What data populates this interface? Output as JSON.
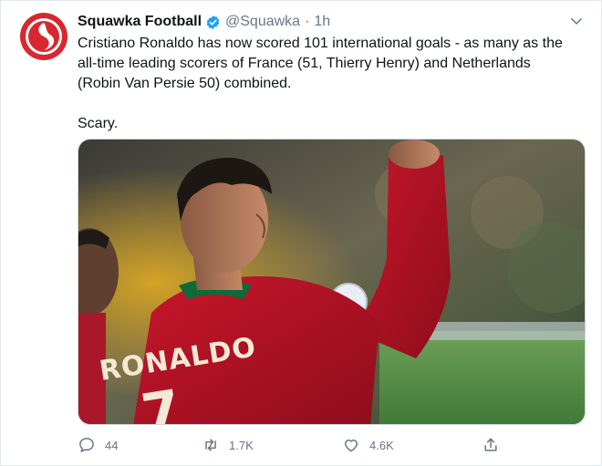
{
  "tweet": {
    "display_name": "Squawka Football",
    "handle": "@Squawka",
    "separator": "·",
    "time": "1h",
    "text_lines": [
      "Cristiano Ronaldo has now scored 101 international goals - as many as the",
      "all-time leading scorers of France (51, Thierry Henry) and Netherlands",
      "(Robin Van Persie 50) combined."
    ],
    "text_line2": "Scary.",
    "media": {
      "jersey_name": "RONALDO",
      "jersey_number": "7"
    },
    "actions": {
      "reply_count": "44",
      "retweet_count": "1.7K",
      "like_count": "4.6K"
    },
    "icons": {
      "avatar": "squawka-logo-icon",
      "verified": "verified-badge-icon",
      "caret": "chevron-down-icon",
      "reply": "reply-icon",
      "retweet": "retweet-icon",
      "like": "heart-icon",
      "share": "share-icon"
    },
    "colors": {
      "brand_red": "#d7282f",
      "verified_blue": "#1da1f2",
      "muted": "#657786",
      "text": "#0f1419"
    }
  }
}
